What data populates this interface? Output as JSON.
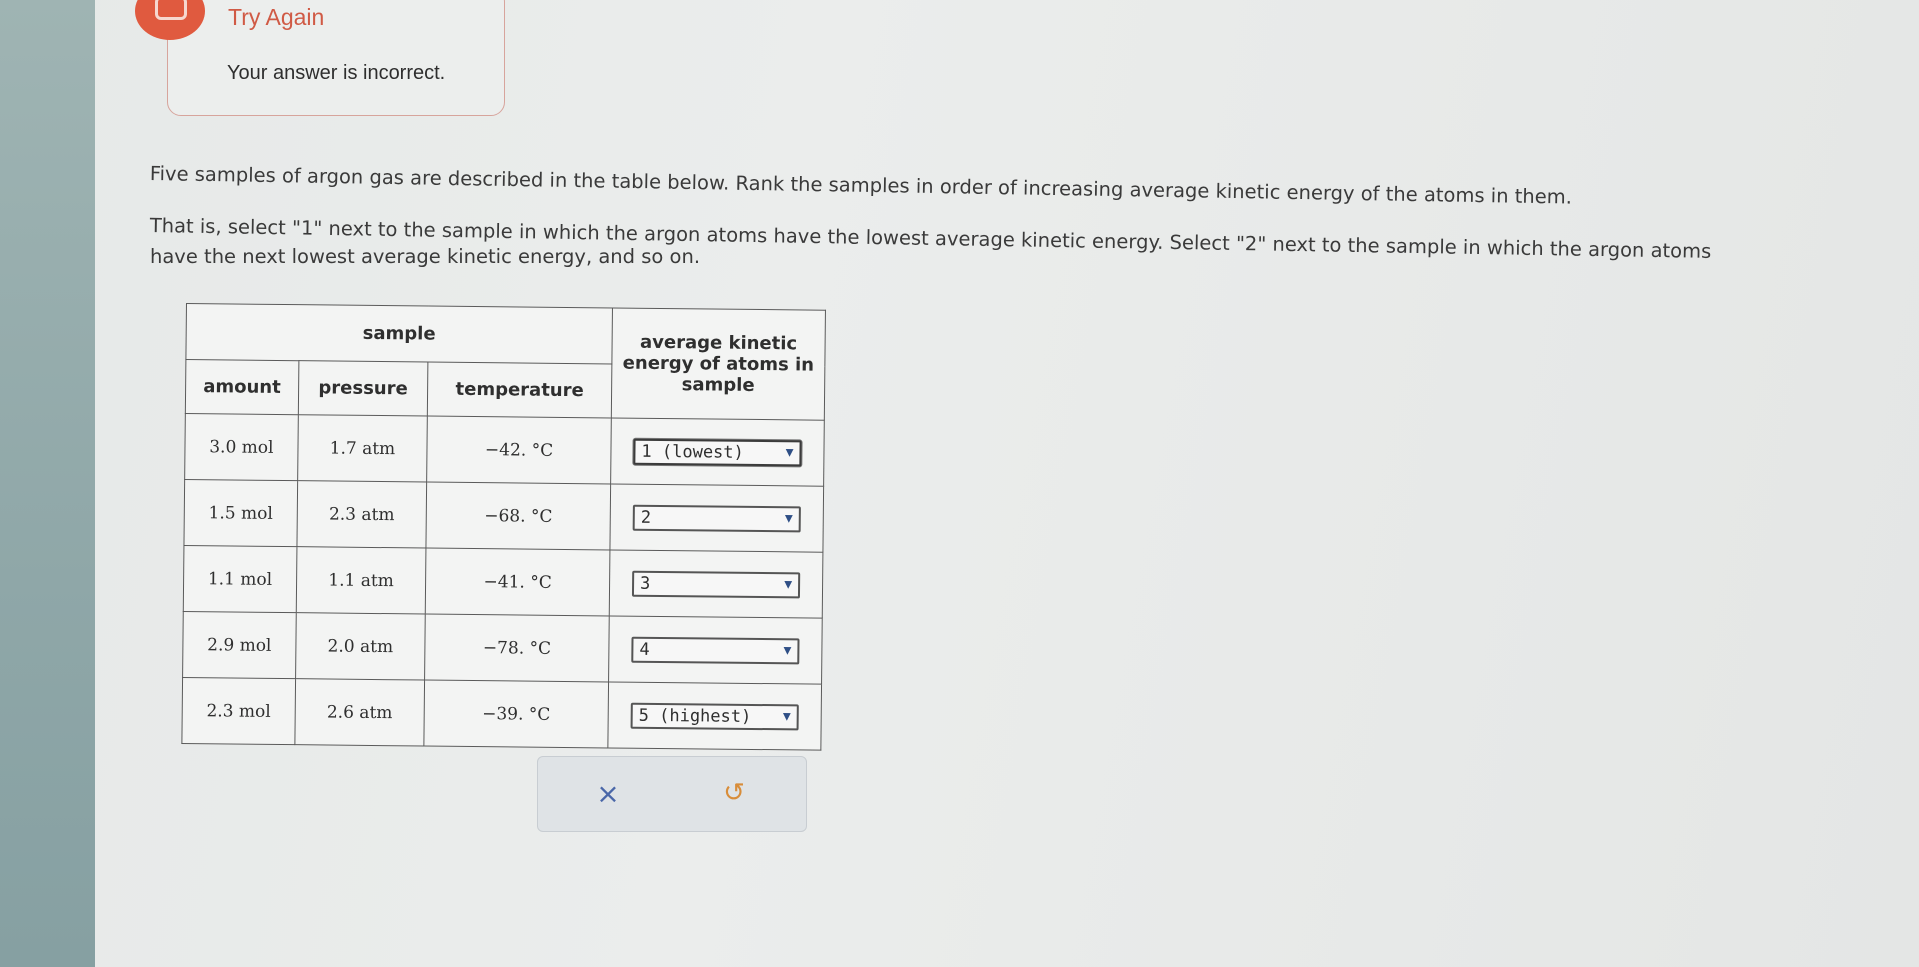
{
  "feedback": {
    "title": "Try Again",
    "message": "Your answer is incorrect."
  },
  "question": {
    "line1": "Five samples of argon gas are described in the table below. Rank the samples in order of increasing average kinetic energy of the atoms in them.",
    "line2": "That is, select \"1\" next to the sample in which the argon atoms have the lowest average kinetic energy. Select \"2\" next to the sample in which the argon atoms",
    "line3": "have the next lowest average kinetic energy, and so on."
  },
  "table": {
    "group_header": "sample",
    "headers": [
      "amount",
      "pressure",
      "temperature"
    ],
    "rank_header": "average kinetic energy of atoms in sample",
    "rows": [
      {
        "amount": "3.0 mol",
        "pressure": "1.7 atm",
        "temperature": "−42. °C",
        "rank": "1 (lowest)"
      },
      {
        "amount": "1.5 mol",
        "pressure": "2.3 atm",
        "temperature": "−68. °C",
        "rank": "2"
      },
      {
        "amount": "1.1 mol",
        "pressure": "1.1 atm",
        "temperature": "−41. °C",
        "rank": "3"
      },
      {
        "amount": "2.9 mol",
        "pressure": "2.0 atm",
        "temperature": "−78. °C",
        "rank": "4"
      },
      {
        "amount": "2.3 mol",
        "pressure": "2.6 atm",
        "temperature": "−39. °C",
        "rank": "5 (highest)"
      }
    ]
  },
  "actions": {
    "clear_glyph": "×",
    "undo_glyph": "↺"
  },
  "colors": {
    "accent_red": "#e05a3f",
    "link_blue": "#4a67a8"
  }
}
